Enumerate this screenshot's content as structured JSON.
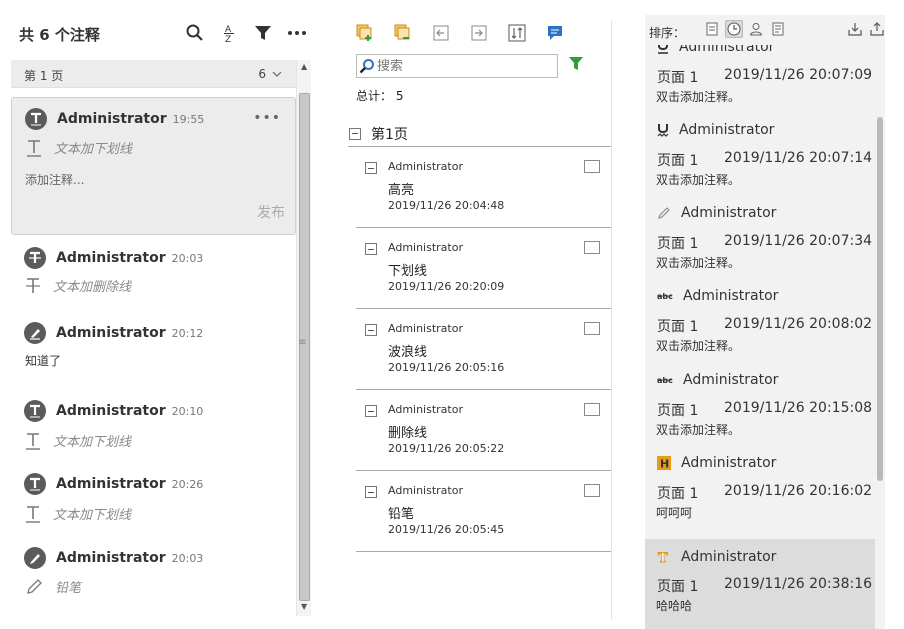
{
  "left": {
    "title": "共 6 个注释",
    "page_label": "第 1 页",
    "page_count": "6",
    "cards": [
      {
        "author": "Administrator",
        "time": "19:55",
        "sub": "文本加下划线",
        "input_placeholder": "添加注释...",
        "publish": "发布",
        "more": "•••"
      },
      {
        "author": "Administrator",
        "time": "20:03",
        "sub": "文本加删除线"
      },
      {
        "author": "Administrator",
        "time": "20:12",
        "content": "知道了"
      },
      {
        "author": "Administrator",
        "time": "20:10",
        "sub": "文本加下划线"
      },
      {
        "author": "Administrator",
        "time": "20:26",
        "sub": "文本加下划线"
      },
      {
        "author": "Administrator",
        "time": "20:03",
        "sub": "铅笔"
      }
    ]
  },
  "middle": {
    "search_placeholder": "搜索",
    "total": "总计： 5",
    "group": "第1页",
    "items": [
      {
        "author": "Administrator",
        "type": "高亮",
        "date": "2019/11/26 20:04:48"
      },
      {
        "author": "Administrator",
        "type": "下划线",
        "date": "2019/11/26 20:20:09"
      },
      {
        "author": "Administrator",
        "type": "波浪线",
        "date": "2019/11/26 20:05:16"
      },
      {
        "author": "Administrator",
        "type": "删除线",
        "date": "2019/11/26 20:05:22"
      },
      {
        "author": "Administrator",
        "type": "铅笔",
        "date": "2019/11/26 20:05:45"
      }
    ]
  },
  "right": {
    "sort_label": "排序：",
    "items": [
      {
        "icon": "underline-icon",
        "author": "Administrator",
        "page": "页面 1",
        "date": "2019/11/26 20:07:09",
        "note": "双击添加注释。"
      },
      {
        "icon": "squiggly-underline-icon",
        "author": "Administrator",
        "page": "页面 1",
        "date": "2019/11/26 20:07:14",
        "note": "双击添加注释。"
      },
      {
        "icon": "pencil-icon",
        "author": "Administrator",
        "page": "页面 1",
        "date": "2019/11/26 20:07:34",
        "note": "双击添加注释。"
      },
      {
        "icon": "strikeout-abc-icon",
        "author": "Administrator",
        "page": "页面 1",
        "date": "2019/11/26 20:08:02",
        "note": "双击添加注释。",
        "glyph": "abc"
      },
      {
        "icon": "strikeout-abc-icon",
        "author": "Administrator",
        "page": "页面 1",
        "date": "2019/11/26 20:15:08",
        "note": "双击添加注释。",
        "glyph": "abc"
      },
      {
        "icon": "highlight-icon",
        "author": "Administrator",
        "page": "页面 1",
        "date": "2019/11/26 20:16:02",
        "note": "呵呵呵",
        "glyph": "H"
      },
      {
        "icon": "text-replace-icon",
        "author": "Administrator",
        "page": "页面 1",
        "date": "2019/11/26 20:38:16",
        "note": "哈哈哈",
        "glyph": "T"
      }
    ]
  },
  "colors": {
    "accent_green": "#2e9c3a",
    "accent_orange": "#e59b1c",
    "accent_blue": "#2a73c8"
  }
}
